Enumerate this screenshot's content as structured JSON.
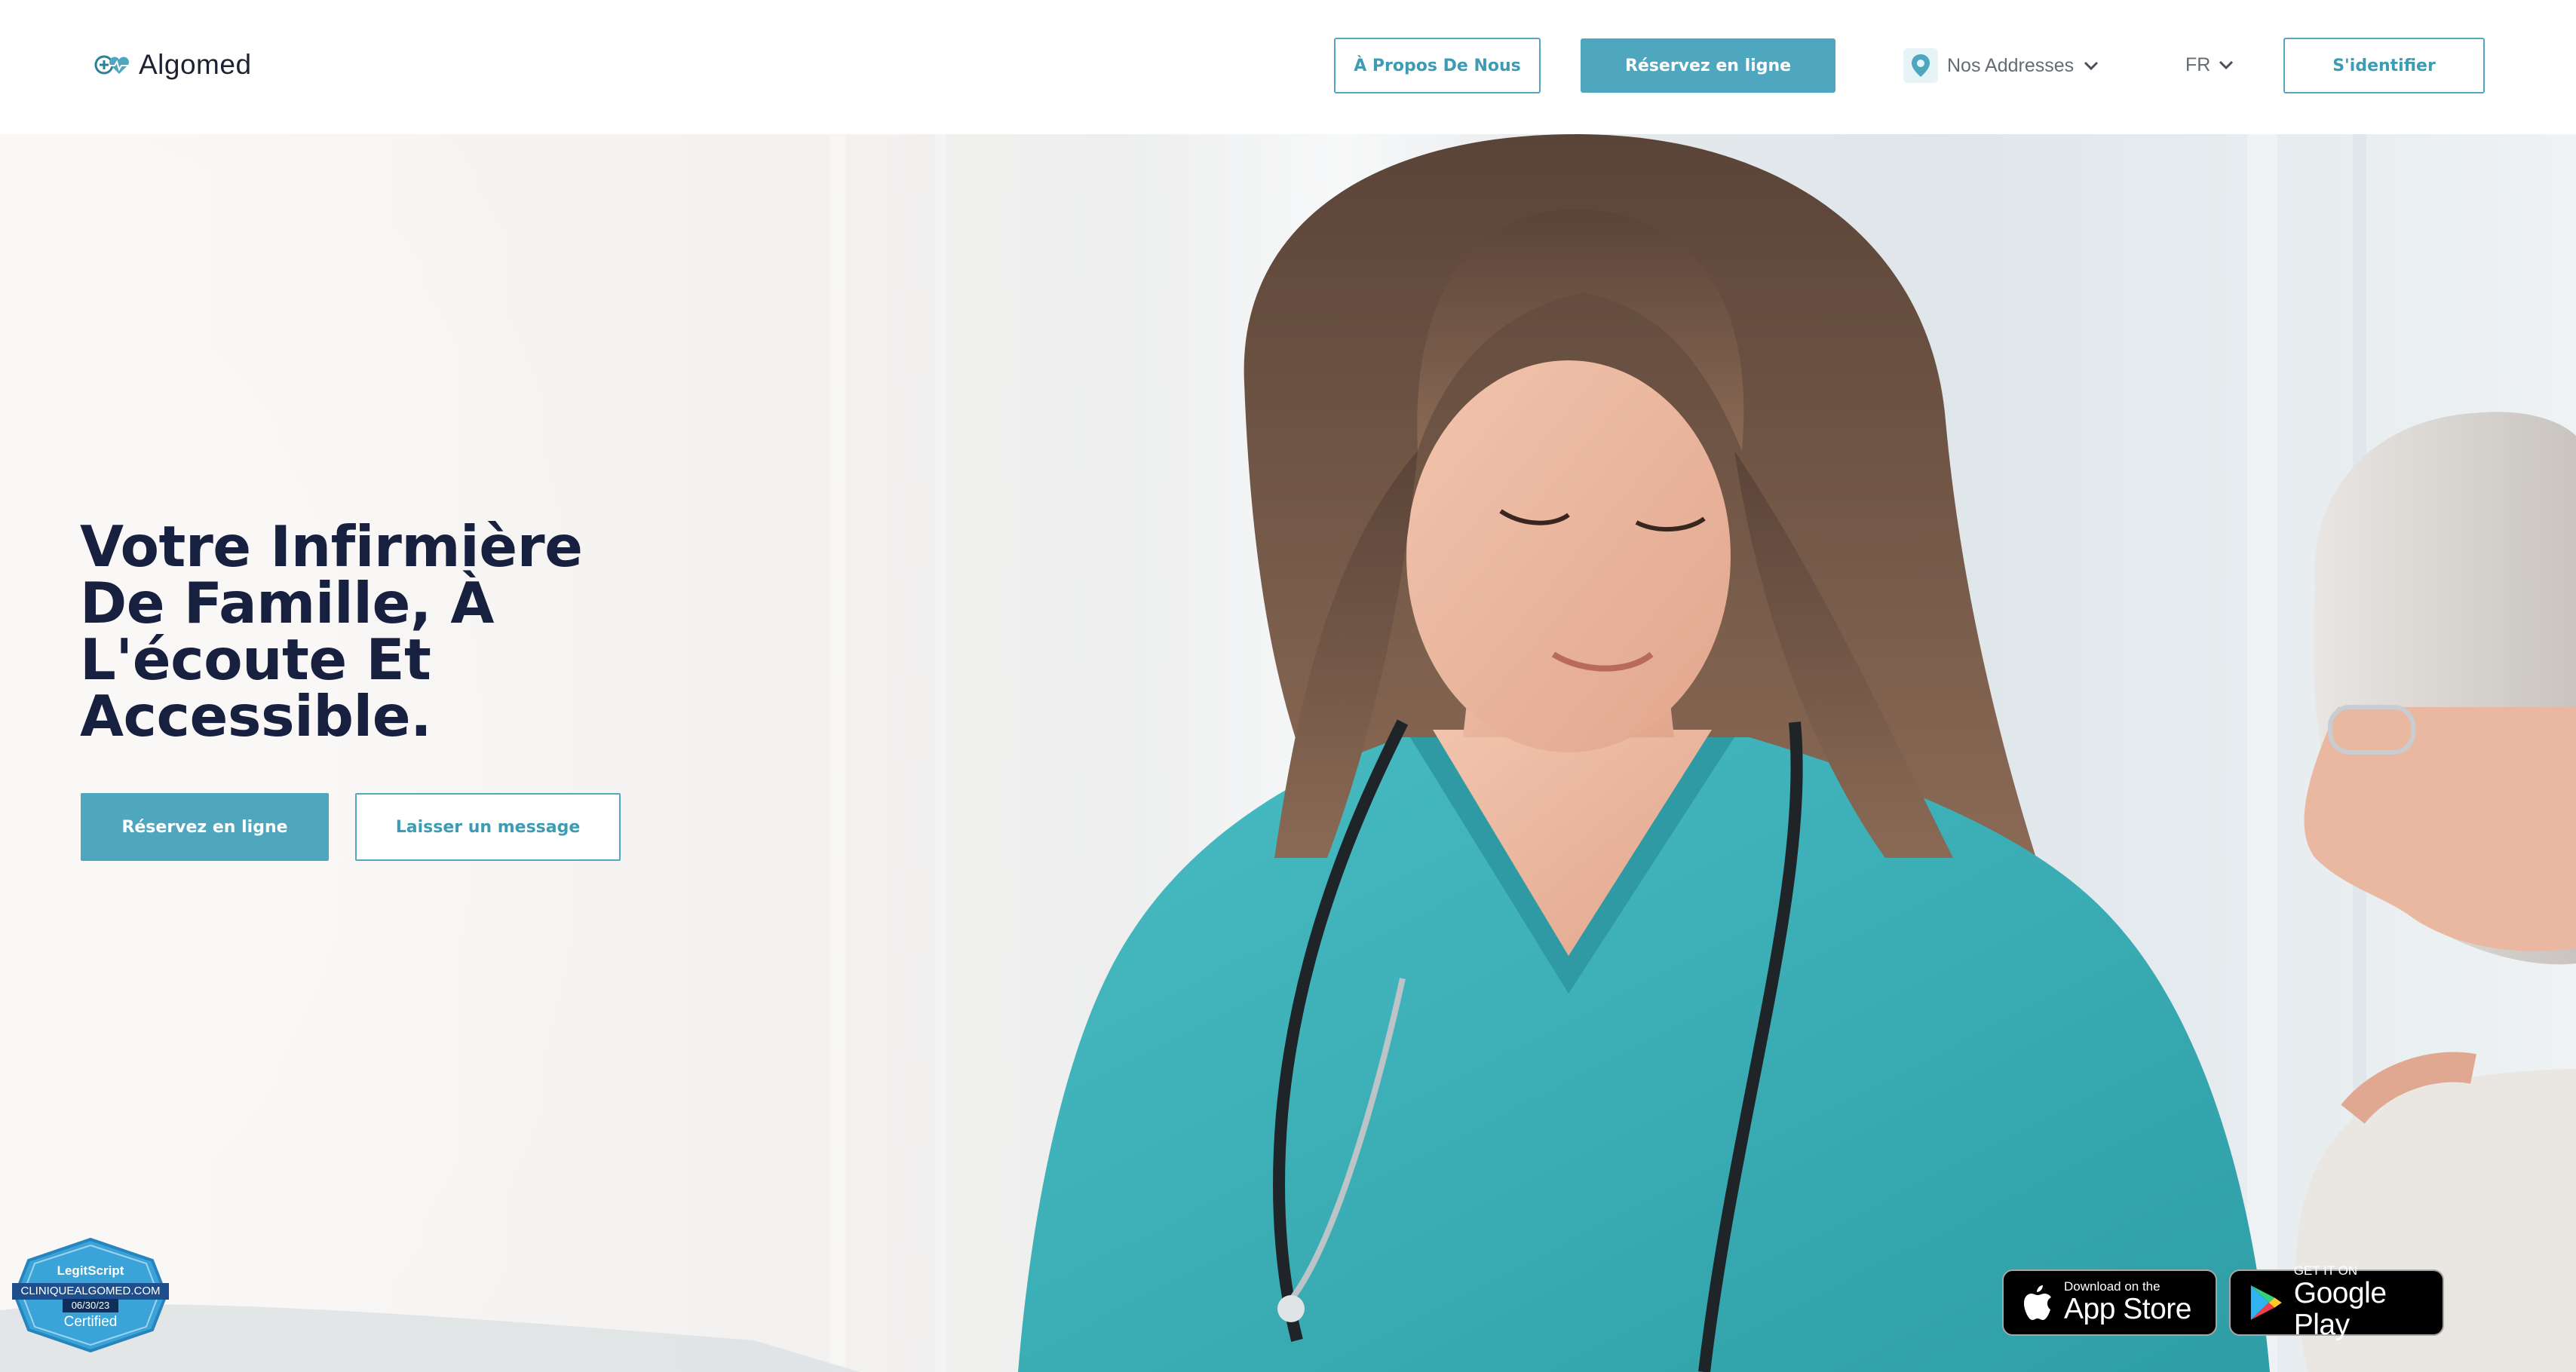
{
  "brand": {
    "name": "Algomed",
    "icon": "heart-plus-logo-icon"
  },
  "header": {
    "about_label": "À Propos De Nous",
    "book_label": "Réservez en ligne",
    "addresses_label": "Nos Addresses",
    "addresses_icon": "location-pin-icon",
    "language_label": "FR",
    "login_label": "S'identifier"
  },
  "hero": {
    "title": "Votre Infirmière De Famille, À L'écoute Et Accessible.",
    "book_label": "Réservez en ligne",
    "message_label": "Laisser un message"
  },
  "badges": {
    "legitscript": {
      "brand": "LegitScript",
      "domain": "CLINIQUEALGOMED.COM",
      "date": "06/30/23",
      "status": "Certified"
    },
    "app_store": {
      "small": "Download on the",
      "big": "App Store"
    },
    "google_play": {
      "small": "GET IT ON",
      "big": "Google Play"
    }
  },
  "colors": {
    "accent": "#4ea7be",
    "title": "#17203f",
    "scrubs": "#3fb0b8"
  }
}
